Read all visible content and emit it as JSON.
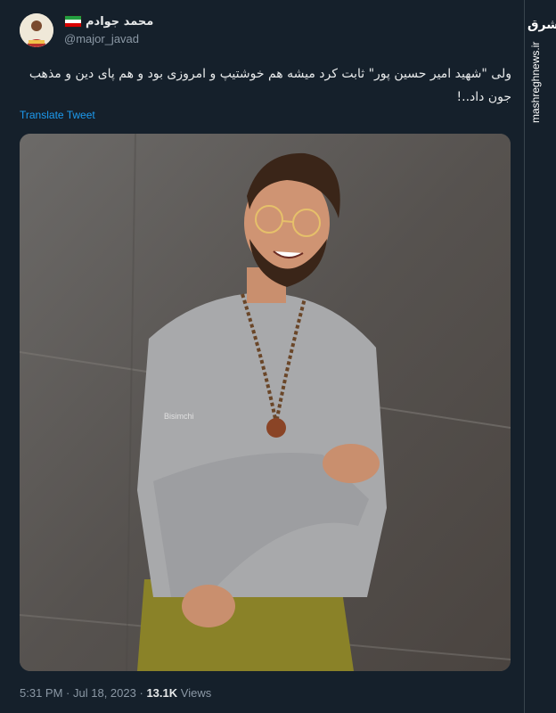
{
  "tweet": {
    "display_name": "محمد جوادم",
    "handle": "@major_javad",
    "text": "ولی \"شهید امیر حسین پور\" ثابت کرد میشه هم خوشتیپ و امروزی بود و هم پای دین و مذهب جون داد..!",
    "translate_label": "Translate Tweet",
    "time": "5:31 PM",
    "separator": "·",
    "date": "Jul 18, 2023",
    "views_count": "13.1K",
    "views_label": "Views"
  },
  "media": {
    "photo_watermark": "Bisimchi"
  },
  "watermark": {
    "logo": "مشرق",
    "site": "mashreghnews.ir"
  },
  "colors": {
    "background": "#15202b",
    "link": "#1d9bf0",
    "muted": "#8b98a5",
    "text": "#e7e9ea"
  },
  "icons": {
    "flag": "iran-flag-icon"
  }
}
